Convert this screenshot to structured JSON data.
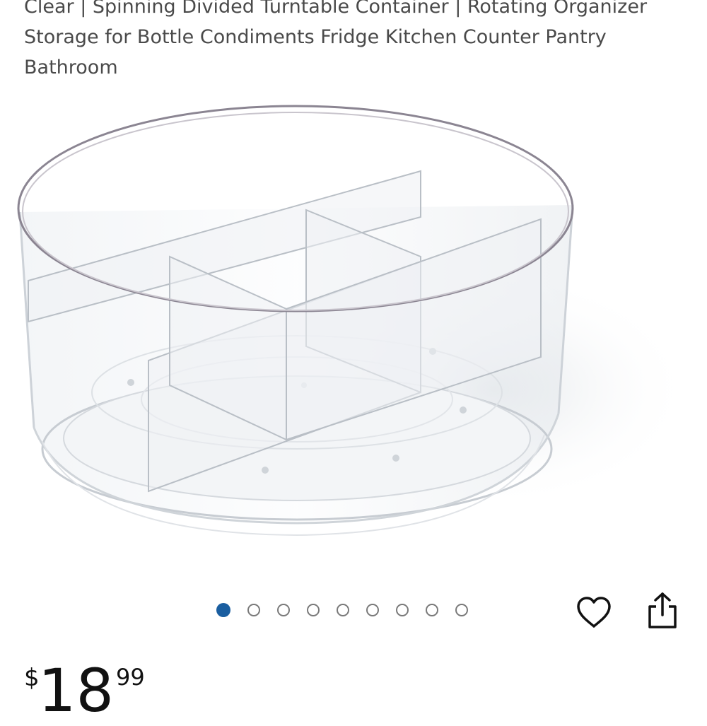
{
  "product": {
    "title": "Clear | Spinning Divided Turntable Container | Rotating Organizer Storage for Bottle Condiments Fridge Kitchen Counter Pantry Bathroom"
  },
  "gallery": {
    "image_label": "clear-rotating-divided-turntable",
    "total_images": 9,
    "active_index": 0,
    "active_color": "#1a5ea0"
  },
  "actions": {
    "favorite_icon": "heart-outline-icon",
    "share_icon": "share-icon"
  },
  "price": {
    "currency_symbol": "$",
    "whole": "18",
    "fraction": "99"
  }
}
